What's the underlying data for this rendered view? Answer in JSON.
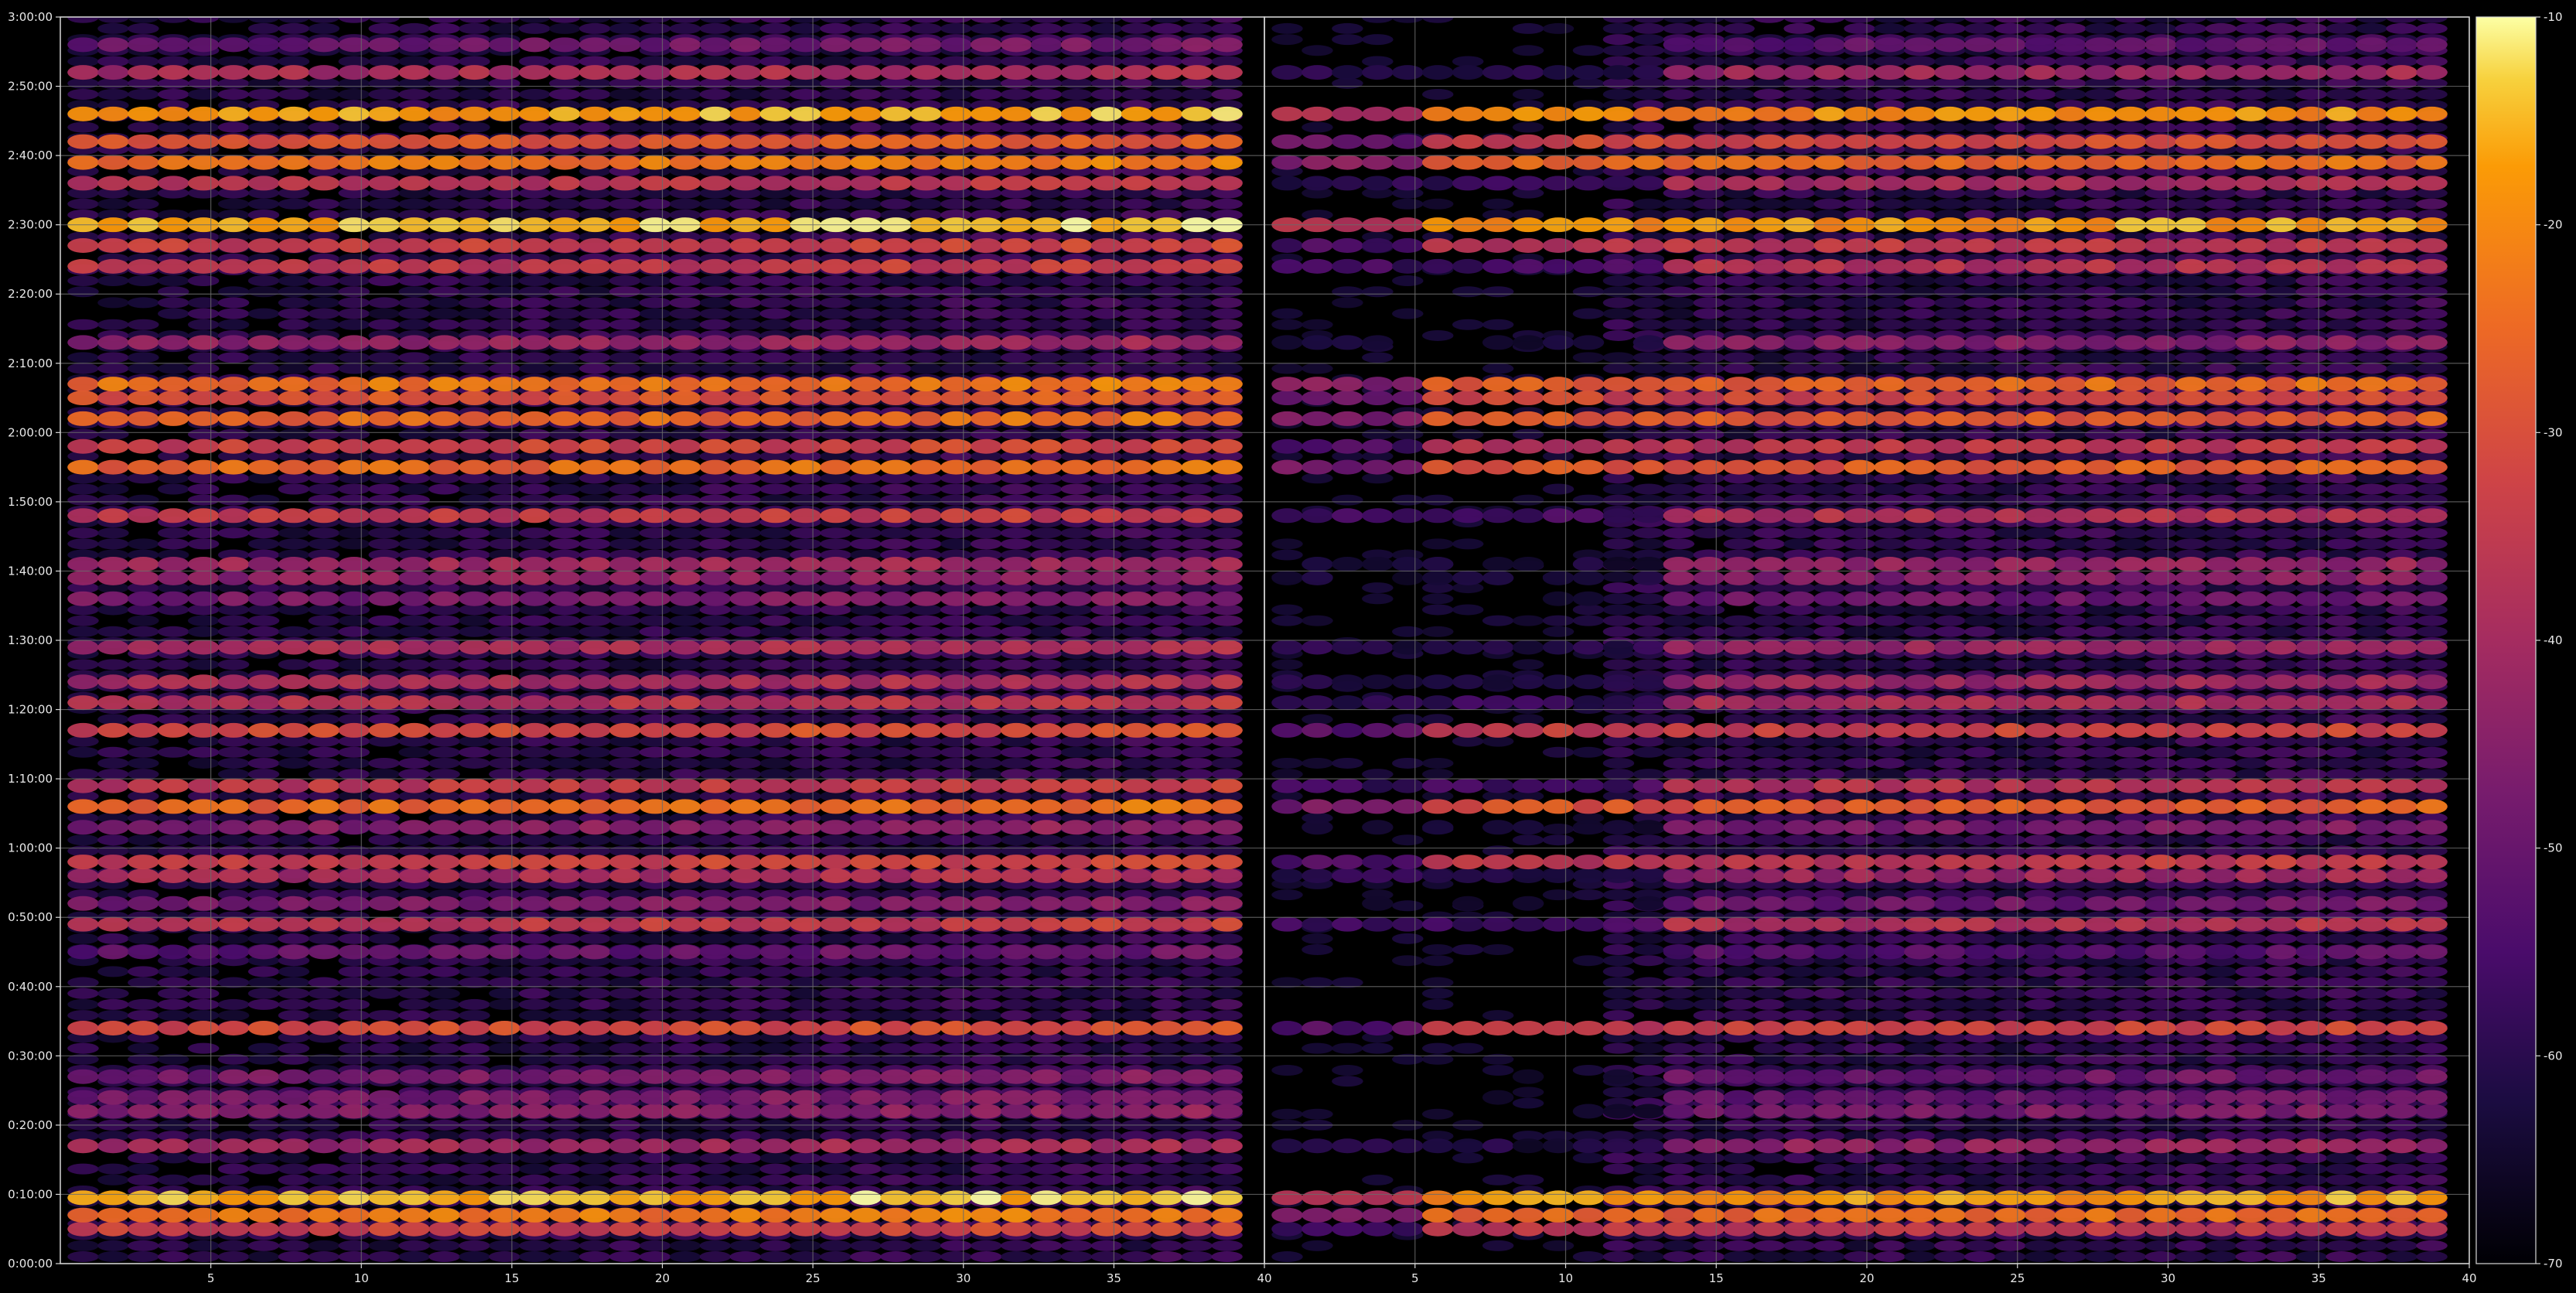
{
  "chart_data": {
    "type": "heatmap",
    "title": "",
    "colormap": "inferno",
    "background_color": "#000000",
    "grid_color": "#6a6a6a",
    "grid": true,
    "y_axis": {
      "range_seconds": [
        0,
        10800
      ],
      "tick_labels": [
        "0:00:00",
        "0:10:00",
        "0:20:00",
        "0:30:00",
        "0:40:00",
        "0:50:00",
        "1:00:00",
        "1:10:00",
        "1:20:00",
        "1:30:00",
        "1:40:00",
        "1:50:00",
        "2:00:00",
        "2:10:00",
        "2:20:00",
        "2:30:00",
        "2:40:00",
        "2:50:00",
        "3:00:00"
      ]
    },
    "panels": [
      {
        "name": "left",
        "x_range": [
          1,
          40
        ],
        "x_ticks": [
          5,
          10,
          15,
          20,
          25,
          30,
          35,
          40
        ],
        "x_tick_labels": [
          "5",
          "10",
          "15",
          "20",
          "25",
          "30",
          "35",
          "40"
        ],
        "label_trend": "rising"
      },
      {
        "name": "right",
        "x_range": [
          1,
          40
        ],
        "x_ticks": [
          5,
          10,
          15,
          20,
          25,
          30,
          35,
          40
        ],
        "x_tick_labels": [
          "5",
          "10",
          "15",
          "20",
          "25",
          "30",
          "35",
          "40"
        ],
        "label_trend": "rising-sparse"
      }
    ],
    "colorbar": {
      "range": [
        -70,
        -10
      ],
      "ticks": [
        -70,
        -60,
        -50,
        -40,
        -30,
        -20,
        -10
      ],
      "tick_labels": [
        "-70",
        "-60",
        "-50",
        "-40",
        "-30",
        "-20",
        "-10"
      ]
    },
    "bands": [
      {
        "time": "0:05:00",
        "s": 300,
        "v": -34
      },
      {
        "time": "0:07:00",
        "s": 420,
        "v": -24
      },
      {
        "time": "0:09:30",
        "s": 570,
        "v": -16
      },
      {
        "time": "0:17:00",
        "s": 1020,
        "v": -42
      },
      {
        "time": "0:22:00",
        "s": 1320,
        "v": -46
      },
      {
        "time": "0:24:00",
        "s": 1440,
        "v": -48
      },
      {
        "time": "0:27:00",
        "s": 1620,
        "v": -48
      },
      {
        "time": "0:34:00",
        "s": 2040,
        "v": -32
      },
      {
        "time": "0:45:00",
        "s": 2700,
        "v": -52
      },
      {
        "time": "0:49:00",
        "s": 2940,
        "v": -36
      },
      {
        "time": "0:52:00",
        "s": 3120,
        "v": -48
      },
      {
        "time": "0:56:00",
        "s": 3360,
        "v": -40
      },
      {
        "time": "0:58:00",
        "s": 3480,
        "v": -34
      },
      {
        "time": "1:03:00",
        "s": 3780,
        "v": -46
      },
      {
        "time": "1:06:00",
        "s": 3960,
        "v": -26
      },
      {
        "time": "1:09:00",
        "s": 4140,
        "v": -36
      },
      {
        "time": "1:17:00",
        "s": 4620,
        "v": -32
      },
      {
        "time": "1:21:00",
        "s": 4860,
        "v": -38
      },
      {
        "time": "1:24:00",
        "s": 5040,
        "v": -40
      },
      {
        "time": "1:29:00",
        "s": 5340,
        "v": -40
      },
      {
        "time": "1:36:00",
        "s": 5760,
        "v": -48
      },
      {
        "time": "1:39:00",
        "s": 5940,
        "v": -44
      },
      {
        "time": "1:41:00",
        "s": 6060,
        "v": -42
      },
      {
        "time": "1:48:00",
        "s": 6480,
        "v": -36
      },
      {
        "time": "1:55:00",
        "s": 6900,
        "v": -26
      },
      {
        "time": "1:58:00",
        "s": 7080,
        "v": -34
      },
      {
        "time": "2:02:00",
        "s": 7320,
        "v": -26
      },
      {
        "time": "2:05:00",
        "s": 7500,
        "v": -30
      },
      {
        "time": "2:07:00",
        "s": 7620,
        "v": -24
      },
      {
        "time": "2:13:00",
        "s": 7980,
        "v": -44
      },
      {
        "time": "2:24:00",
        "s": 8640,
        "v": -36
      },
      {
        "time": "2:27:00",
        "s": 8820,
        "v": -34
      },
      {
        "time": "2:30:00",
        "s": 9000,
        "v": -16
      },
      {
        "time": "2:36:00",
        "s": 9360,
        "v": -38
      },
      {
        "time": "2:39:00",
        "s": 9540,
        "v": -24
      },
      {
        "time": "2:42:00",
        "s": 9720,
        "v": -30
      },
      {
        "time": "2:46:00",
        "s": 9960,
        "v": -18
      },
      {
        "time": "2:52:00",
        "s": 10320,
        "v": -40
      },
      {
        "time": "2:56:00",
        "s": 10560,
        "v": -50
      }
    ]
  }
}
